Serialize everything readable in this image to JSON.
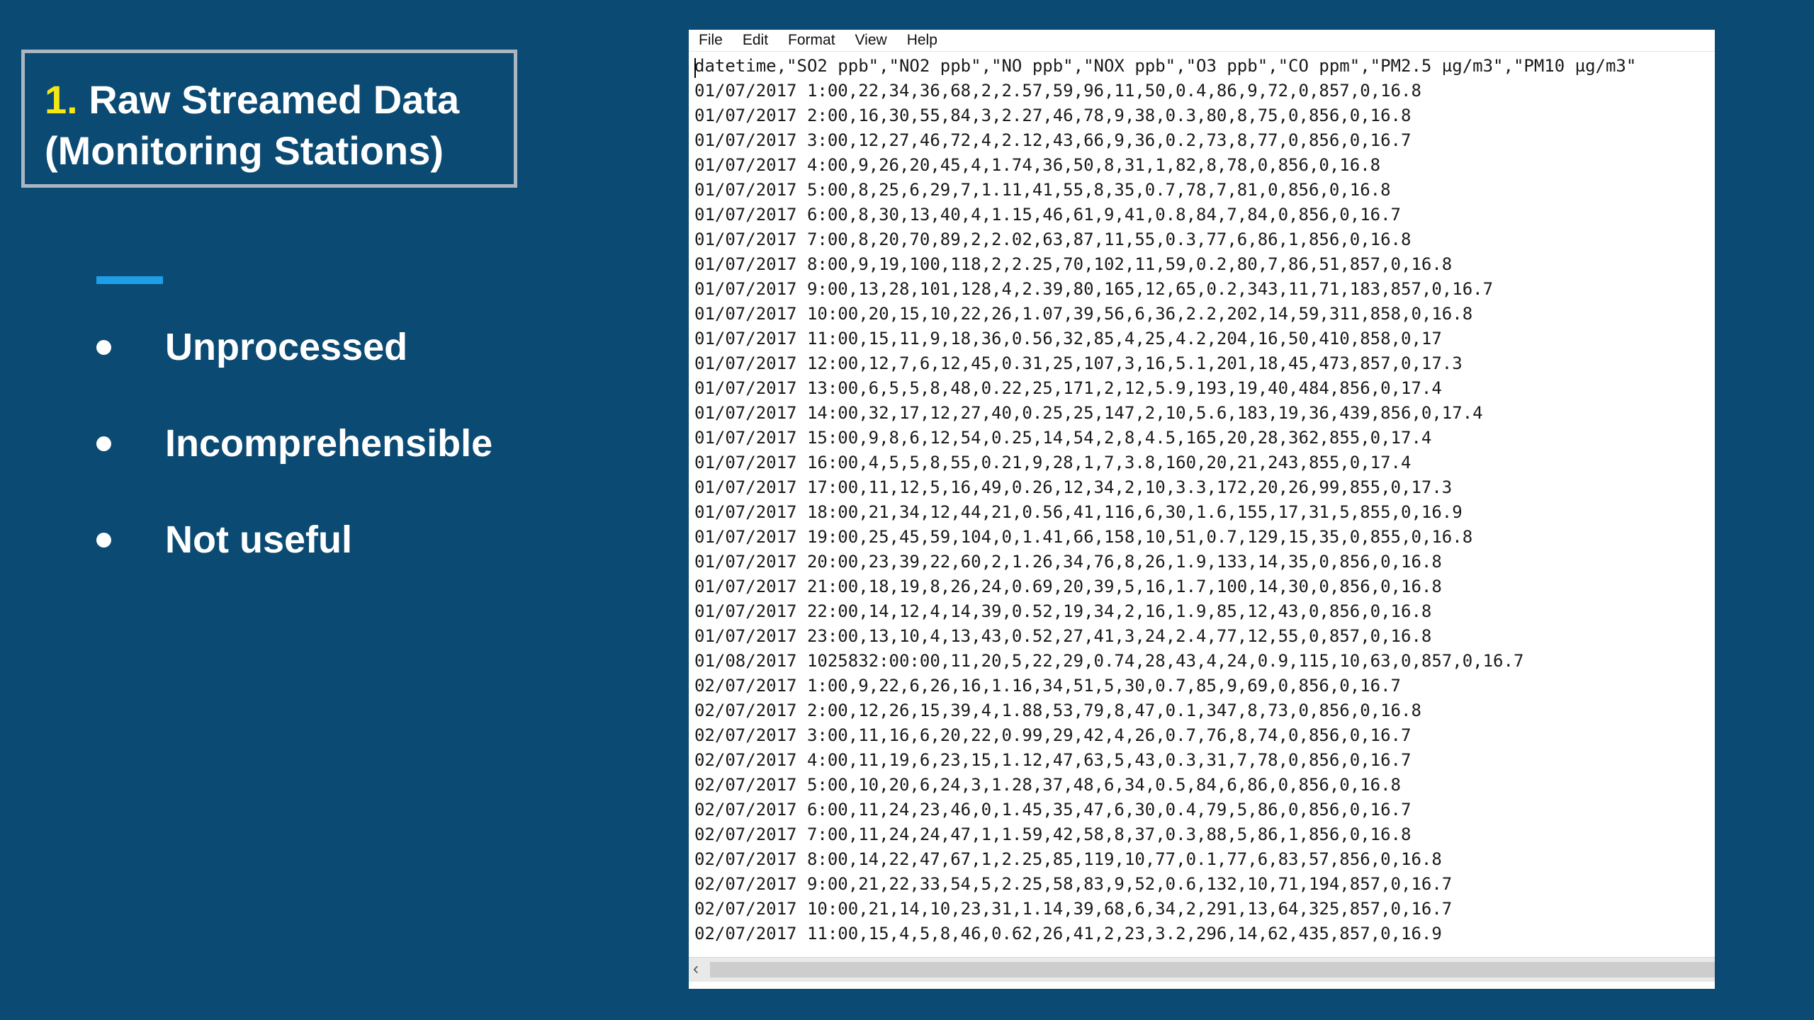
{
  "slide": {
    "title_number": "1.",
    "title_line1": "Raw Streamed Data",
    "title_line2": "(Monitoring Stations)",
    "bullets": [
      "Unprocessed",
      "Incomprehensible",
      "Not useful"
    ],
    "colors": {
      "background": "#0b4a73",
      "accent": "#1e9ee6",
      "title_number": "#f5e614"
    }
  },
  "notepad": {
    "menu": [
      "File",
      "Edit",
      "Format",
      "View",
      "Help"
    ],
    "lines": [
      "datetime,\"SO2 ppb\",\"NO2 ppb\",\"NO ppb\",\"NOX ppb\",\"O3 ppb\",\"CO ppm\",\"PM2.5 µg/m3\",\"PM10 µg/m3\"",
      "01/07/2017 1:00,22,34,36,68,2,2.57,59,96,11,50,0.4,86,9,72,0,857,0,16.8",
      "01/07/2017 2:00,16,30,55,84,3,2.27,46,78,9,38,0.3,80,8,75,0,856,0,16.8",
      "01/07/2017 3:00,12,27,46,72,4,2.12,43,66,9,36,0.2,73,8,77,0,856,0,16.7",
      "01/07/2017 4:00,9,26,20,45,4,1.74,36,50,8,31,1,82,8,78,0,856,0,16.8",
      "01/07/2017 5:00,8,25,6,29,7,1.11,41,55,8,35,0.7,78,7,81,0,856,0,16.8",
      "01/07/2017 6:00,8,30,13,40,4,1.15,46,61,9,41,0.8,84,7,84,0,856,0,16.7",
      "01/07/2017 7:00,8,20,70,89,2,2.02,63,87,11,55,0.3,77,6,86,1,856,0,16.8",
      "01/07/2017 8:00,9,19,100,118,2,2.25,70,102,11,59,0.2,80,7,86,51,857,0,16.8",
      "01/07/2017 9:00,13,28,101,128,4,2.39,80,165,12,65,0.2,343,11,71,183,857,0,16.7",
      "01/07/2017 10:00,20,15,10,22,26,1.07,39,56,6,36,2.2,202,14,59,311,858,0,16.8",
      "01/07/2017 11:00,15,11,9,18,36,0.56,32,85,4,25,4.2,204,16,50,410,858,0,17",
      "01/07/2017 12:00,12,7,6,12,45,0.31,25,107,3,16,5.1,201,18,45,473,857,0,17.3",
      "01/07/2017 13:00,6,5,5,8,48,0.22,25,171,2,12,5.9,193,19,40,484,856,0,17.4",
      "01/07/2017 14:00,32,17,12,27,40,0.25,25,147,2,10,5.6,183,19,36,439,856,0,17.4",
      "01/07/2017 15:00,9,8,6,12,54,0.25,14,54,2,8,4.5,165,20,28,362,855,0,17.4",
      "01/07/2017 16:00,4,5,5,8,55,0.21,9,28,1,7,3.8,160,20,21,243,855,0,17.4",
      "01/07/2017 17:00,11,12,5,16,49,0.26,12,34,2,10,3.3,172,20,26,99,855,0,17.3",
      "01/07/2017 18:00,21,34,12,44,21,0.56,41,116,6,30,1.6,155,17,31,5,855,0,16.9",
      "01/07/2017 19:00,25,45,59,104,0,1.41,66,158,10,51,0.7,129,15,35,0,855,0,16.8",
      "01/07/2017 20:00,23,39,22,60,2,1.26,34,76,8,26,1.9,133,14,35,0,856,0,16.8",
      "01/07/2017 21:00,18,19,8,26,24,0.69,20,39,5,16,1.7,100,14,30,0,856,0,16.8",
      "01/07/2017 22:00,14,12,4,14,39,0.52,19,34,2,16,1.9,85,12,43,0,856,0,16.8",
      "01/07/2017 23:00,13,10,4,13,43,0.52,27,41,3,24,2.4,77,12,55,0,857,0,16.8",
      "01/08/2017 1025832:00:00,11,20,5,22,29,0.74,28,43,4,24,0.9,115,10,63,0,857,0,16.7",
      "02/07/2017 1:00,9,22,6,26,16,1.16,34,51,5,30,0.7,85,9,69,0,856,0,16.7",
      "02/07/2017 2:00,12,26,15,39,4,1.88,53,79,8,47,0.1,347,8,73,0,856,0,16.8",
      "02/07/2017 3:00,11,16,6,20,22,0.99,29,42,4,26,0.7,76,8,74,0,856,0,16.7",
      "02/07/2017 4:00,11,19,6,23,15,1.12,47,63,5,43,0.3,31,7,78,0,856,0,16.7",
      "02/07/2017 5:00,10,20,6,24,3,1.28,37,48,6,34,0.5,84,6,86,0,856,0,16.8",
      "02/07/2017 6:00,11,24,23,46,0,1.45,35,47,6,30,0.4,79,5,86,0,856,0,16.7",
      "02/07/2017 7:00,11,24,24,47,1,1.59,42,58,8,37,0.3,88,5,86,1,856,0,16.8",
      "02/07/2017 8:00,14,22,47,67,1,2.25,85,119,10,77,0.1,77,6,83,57,856,0,16.8",
      "02/07/2017 9:00,21,22,33,54,5,2.25,58,83,9,52,0.6,132,10,71,194,857,0,16.7",
      "02/07/2017 10:00,21,14,10,23,31,1.14,39,68,6,34,2,291,13,64,325,857,0,16.7",
      "02/07/2017 11:00,15,4,5,8,46,0.62,26,41,2,23,3.2,296,14,62,435,857,0,16.9"
    ]
  }
}
